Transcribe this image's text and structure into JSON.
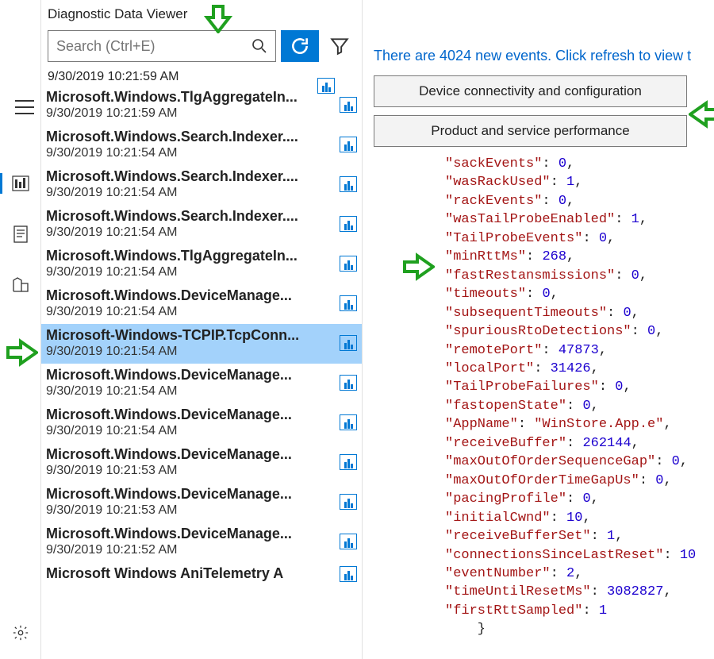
{
  "title": "Diagnostic Data Viewer",
  "search": {
    "placeholder": "Search (Ctrl+E)"
  },
  "banner": "There are 4024 new events. Click refresh to view t",
  "categories": [
    "Device connectivity and configuration",
    "Product and service performance"
  ],
  "events": [
    {
      "name": "",
      "ts": "9/30/2019 10:21:59 AM"
    },
    {
      "name": "Microsoft.Windows.TlgAggregateIn...",
      "ts": "9/30/2019 10:21:59 AM"
    },
    {
      "name": "Microsoft.Windows.Search.Indexer....",
      "ts": "9/30/2019 10:21:54 AM"
    },
    {
      "name": "Microsoft.Windows.Search.Indexer....",
      "ts": "9/30/2019 10:21:54 AM"
    },
    {
      "name": "Microsoft.Windows.Search.Indexer....",
      "ts": "9/30/2019 10:21:54 AM"
    },
    {
      "name": "Microsoft.Windows.TlgAggregateIn...",
      "ts": "9/30/2019 10:21:54 AM"
    },
    {
      "name": "Microsoft.Windows.DeviceManage...",
      "ts": "9/30/2019 10:21:54 AM"
    },
    {
      "name": "Microsoft-Windows-TCPIP.TcpConn...",
      "ts": "9/30/2019 10:21:54 AM",
      "selected": true
    },
    {
      "name": "Microsoft.Windows.DeviceManage...",
      "ts": "9/30/2019 10:21:54 AM"
    },
    {
      "name": "Microsoft.Windows.DeviceManage...",
      "ts": "9/30/2019 10:21:54 AM"
    },
    {
      "name": "Microsoft.Windows.DeviceManage...",
      "ts": "9/30/2019 10:21:53 AM"
    },
    {
      "name": "Microsoft.Windows.DeviceManage...",
      "ts": "9/30/2019 10:21:53 AM"
    },
    {
      "name": "Microsoft.Windows.DeviceManage...",
      "ts": "9/30/2019 10:21:52 AM"
    },
    {
      "name": "Microsoft Windows AniTelemetry A",
      "ts": ""
    }
  ],
  "json_fields": [
    {
      "k": "sackEvents",
      "v": 0,
      "t": "n",
      "comma": true
    },
    {
      "k": "wasRackUsed",
      "v": 1,
      "t": "n",
      "comma": true
    },
    {
      "k": "rackEvents",
      "v": 0,
      "t": "n",
      "comma": true
    },
    {
      "k": "wasTailProbeEnabled",
      "v": 1,
      "t": "n",
      "comma": true
    },
    {
      "k": "TailProbeEvents",
      "v": 0,
      "t": "n",
      "comma": true
    },
    {
      "k": "minRttMs",
      "v": 268,
      "t": "n",
      "comma": true
    },
    {
      "k": "fastRestansmissions",
      "v": 0,
      "t": "n",
      "comma": true
    },
    {
      "k": "timeouts",
      "v": 0,
      "t": "n",
      "comma": true
    },
    {
      "k": "subsequentTimeouts",
      "v": 0,
      "t": "n",
      "comma": true
    },
    {
      "k": "spuriousRtoDetections",
      "v": 0,
      "t": "n",
      "comma": true
    },
    {
      "k": "remotePort",
      "v": 47873,
      "t": "n",
      "comma": true
    },
    {
      "k": "localPort",
      "v": 31426,
      "t": "n",
      "comma": true
    },
    {
      "k": "TailProbeFailures",
      "v": 0,
      "t": "n",
      "comma": true
    },
    {
      "k": "fastopenState",
      "v": 0,
      "t": "n",
      "comma": true
    },
    {
      "k": "AppName",
      "v": "WinStore.App.e",
      "t": "s",
      "comma": true
    },
    {
      "k": "receiveBuffer",
      "v": 262144,
      "t": "n",
      "comma": true
    },
    {
      "k": "maxOutOfOrderSequenceGap",
      "v": 0,
      "t": "n",
      "comma": true
    },
    {
      "k": "maxOutOfOrderTimeGapUs",
      "v": 0,
      "t": "n",
      "comma": true
    },
    {
      "k": "pacingProfile",
      "v": 0,
      "t": "n",
      "comma": true
    },
    {
      "k": "initialCwnd",
      "v": 10,
      "t": "n",
      "comma": true
    },
    {
      "k": "receiveBufferSet",
      "v": 1,
      "t": "n",
      "comma": true
    },
    {
      "k": "connectionsSinceLastReset",
      "v": "10",
      "t": "n",
      "comma": false
    },
    {
      "k": "eventNumber",
      "v": 2,
      "t": "n",
      "comma": true
    },
    {
      "k": "timeUntilResetMs",
      "v": 3082827,
      "t": "n",
      "comma": true
    },
    {
      "k": "firstRttSampled",
      "v": 1,
      "t": "n",
      "comma": false
    }
  ],
  "json_close": "    }"
}
